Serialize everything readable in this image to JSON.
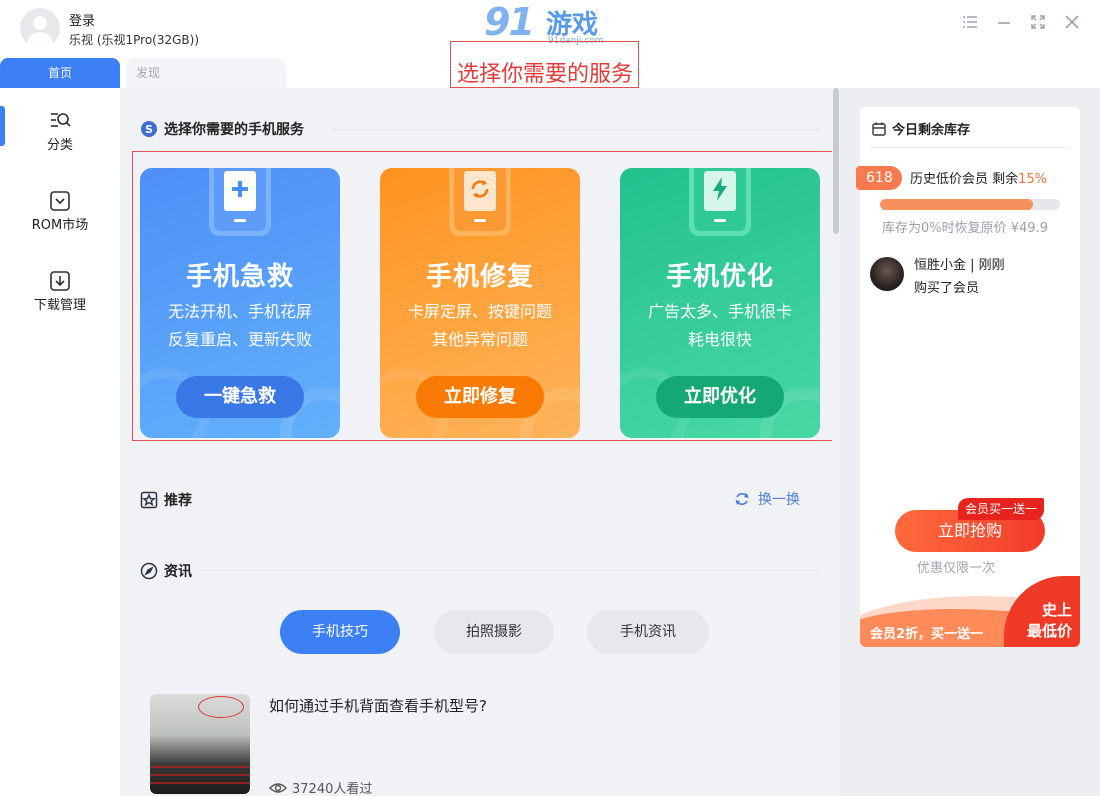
{
  "header": {
    "login_label": "登录",
    "device_label": "乐视 (乐视1Pro(32GB))",
    "logo_main": "91",
    "logo_title": "游戏",
    "logo_sub": "91danji.com"
  },
  "annotation": {
    "text": "选择你需要的服务"
  },
  "tabs": [
    {
      "label": "首页",
      "active": true
    },
    {
      "label": "发现",
      "active": false
    }
  ],
  "window_controls": [
    "menu-icon",
    "minimize-icon",
    "maximize-icon",
    "close-icon"
  ],
  "sidebar": {
    "items": [
      {
        "label": "分类",
        "icon": "category-icon",
        "active": true
      },
      {
        "label": "ROM市场",
        "icon": "rom-market-icon",
        "active": false
      },
      {
        "label": "下载管理",
        "icon": "download-icon",
        "active": false
      }
    ]
  },
  "services": {
    "section_title": "选择你需要的手机服务",
    "cards": [
      {
        "title": "手机急救",
        "desc1": "无法开机、手机花屏",
        "desc2": "反复重启、更新失败",
        "button": "一键急救",
        "color": "#4d8ff8",
        "icon": "plus-icon"
      },
      {
        "title": "手机修复",
        "desc1": "卡屏定屏、按键问题",
        "desc2": "其他异常问题",
        "button": "立即修复",
        "color": "#ff9320",
        "icon": "repair-icon"
      },
      {
        "title": "手机优化",
        "desc1": "广告太多、手机很卡",
        "desc2": "耗电很快",
        "button": "立即优化",
        "color": "#22c18e",
        "icon": "lightning-icon"
      }
    ]
  },
  "recommend": {
    "title": "推荐",
    "refresh_label": "换一换"
  },
  "news": {
    "title": "资讯",
    "tabs": [
      {
        "label": "手机技巧",
        "active": true
      },
      {
        "label": "拍照摄影",
        "active": false
      },
      {
        "label": "手机资讯",
        "active": false
      }
    ],
    "items": [
      {
        "title": "如何通过手机背面查看手机型号?",
        "views": "37240人看过"
      }
    ]
  },
  "right_panel": {
    "title": "今日剩余库存",
    "badge": "618",
    "item_label": "历史低价会员 剩余",
    "remaining_pct": "15%",
    "progress_fraction": 0.85,
    "restore_text": "库存为0%时恢复原价 ¥49.9",
    "buyer_name": "恒胜小金 | 刚刚",
    "buyer_action": "购买了会员",
    "tag": "会员买一送一",
    "buy_button": "立即抢购",
    "limit_text": "优惠仅限一次",
    "promo_text": "会员2折，买一送一",
    "corner_line1": "史上",
    "corner_line2": "最低价"
  },
  "colors": {
    "accent": "#3d7ff5",
    "annotation": "#e23b3b",
    "promo": "#f23c2a"
  }
}
